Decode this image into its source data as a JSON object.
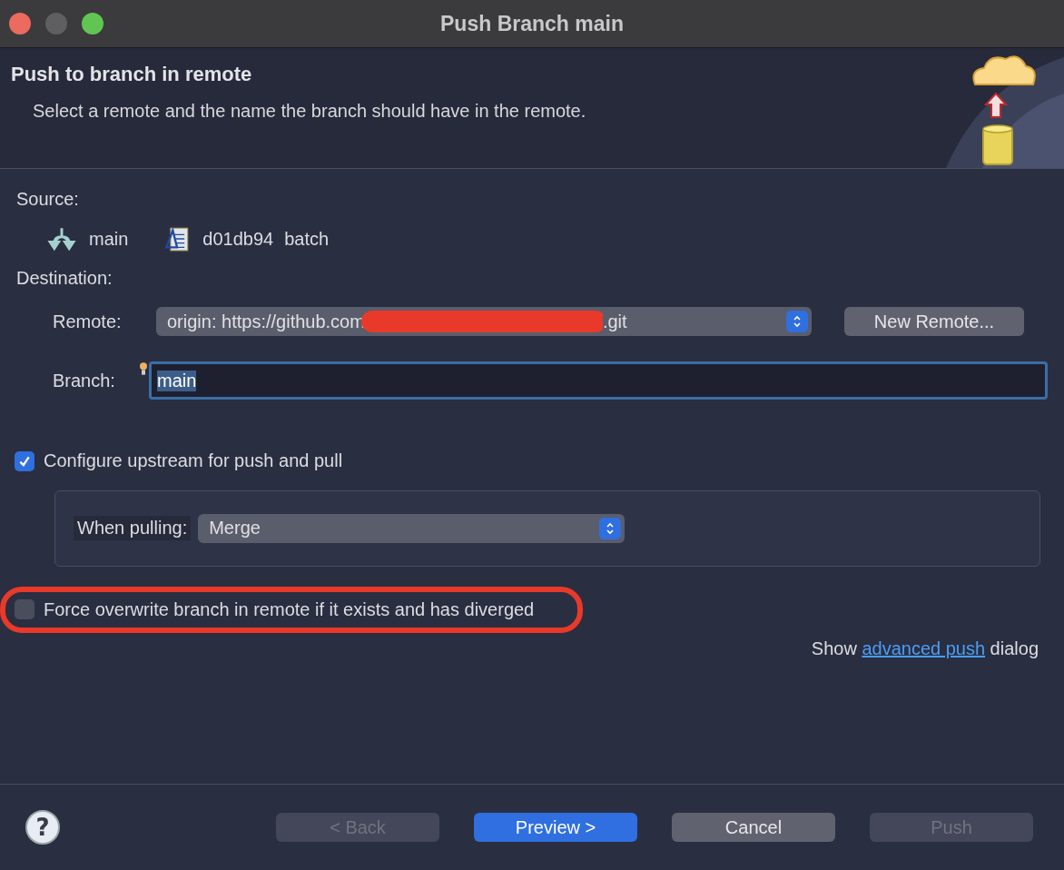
{
  "window": {
    "title": "Push Branch main"
  },
  "header": {
    "title": "Push to branch in remote",
    "description": "Select a remote and the name the branch should have in the remote."
  },
  "source": {
    "label": "Source:",
    "branch": "main",
    "commit_id": "d01db94",
    "commit_message": "batch"
  },
  "destination": {
    "label": "Destination:",
    "remote": {
      "label": "Remote:",
      "value_start": "origin: https://github.com",
      "value_end": ".git",
      "redacted": true
    },
    "new_remote_button": "New Remote...",
    "branch": {
      "label": "Branch:",
      "value": "main",
      "selected_text": true
    }
  },
  "configure_upstream": {
    "label": "Configure upstream for push and pull",
    "checked": true,
    "when_pulling": {
      "label": "When pulling:",
      "value": "Merge"
    }
  },
  "force_overwrite": {
    "label": "Force overwrite branch in remote if it exists and has diverged",
    "checked": false,
    "highlighted": true
  },
  "advanced": {
    "before": "Show",
    "link": "advanced push",
    "after": "dialog"
  },
  "help_button": {
    "label": "?"
  },
  "buttons": [
    {
      "label": "< Back",
      "kind": "normal",
      "disabled": true
    },
    {
      "label": "Preview >",
      "kind": "default",
      "disabled": false
    },
    {
      "label": "Cancel",
      "kind": "normal",
      "disabled": false
    },
    {
      "label": "Push",
      "kind": "normal",
      "disabled": true
    }
  ]
}
